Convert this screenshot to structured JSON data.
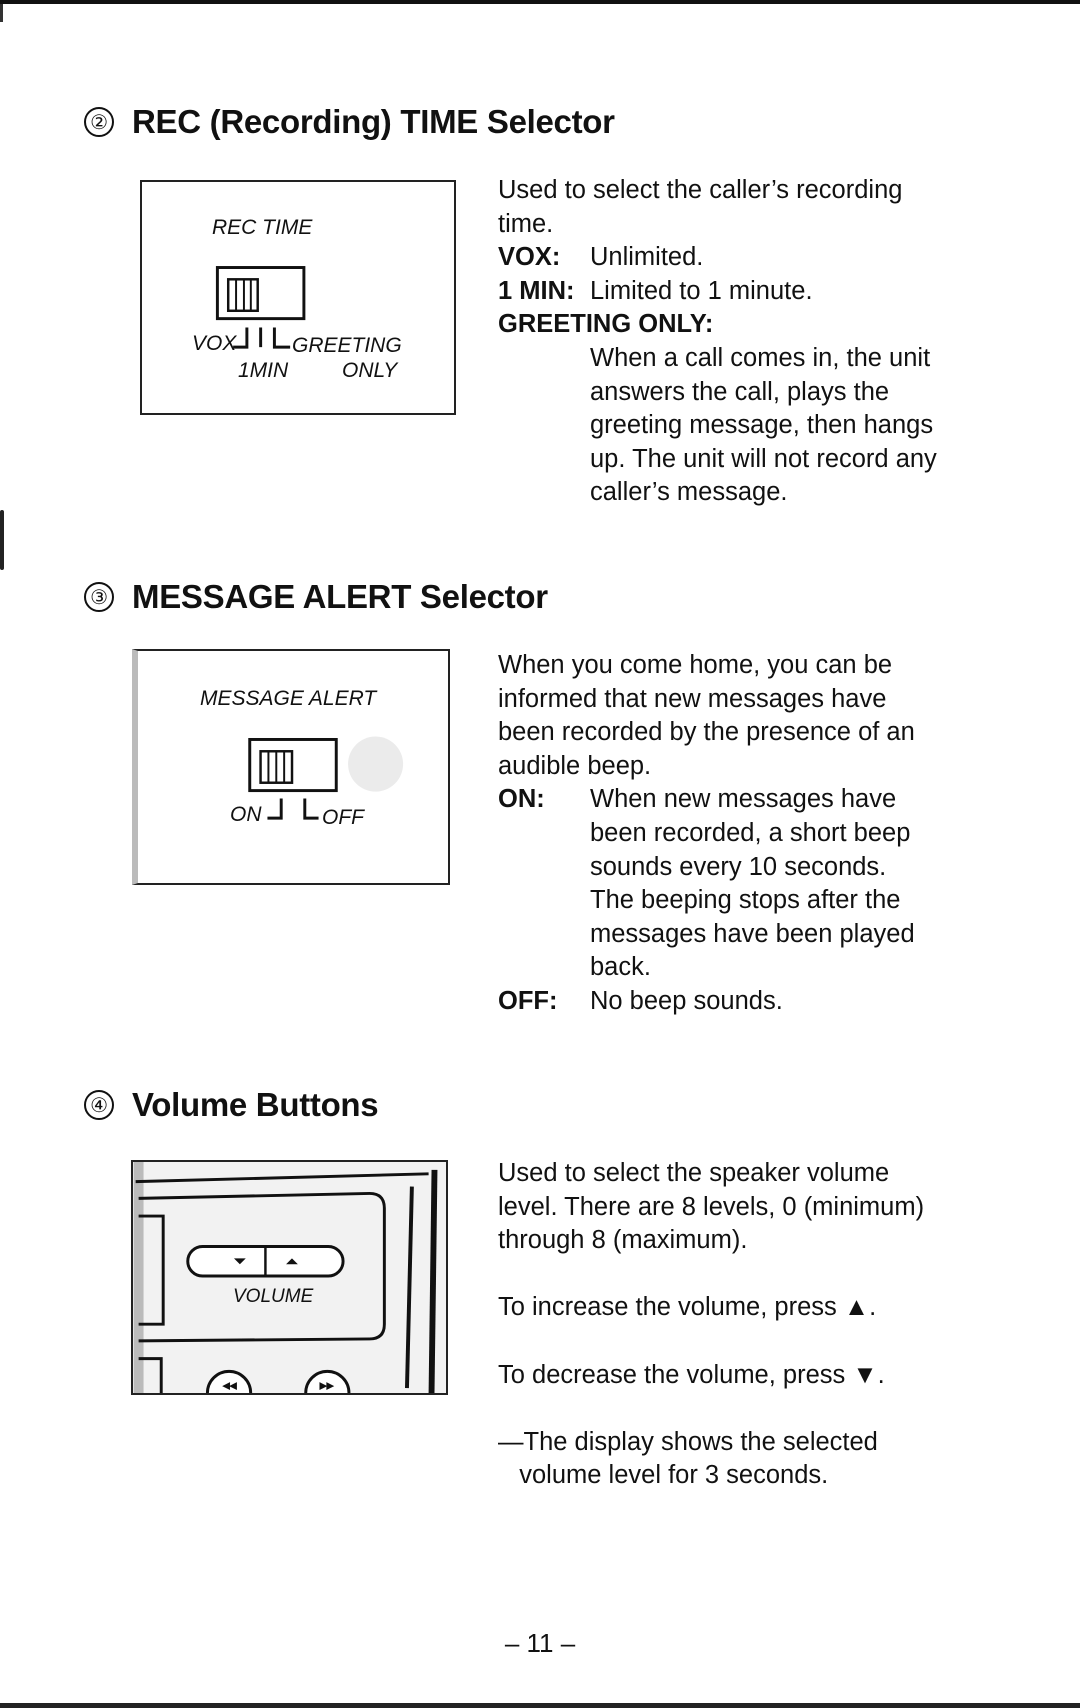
{
  "page_number": "– 11 –",
  "sections": [
    {
      "number": "②",
      "title": "REC (Recording) TIME Selector",
      "diagram": {
        "label": "REC TIME",
        "left_label": "VOX",
        "right_label": "GREETING",
        "below_center": "1MIN",
        "below_right": "ONLY"
      },
      "intro": [
        "Used to select the caller’s recording",
        "time."
      ],
      "items": [
        {
          "label": "VOX:",
          "text": [
            "Unlimited."
          ]
        },
        {
          "label": "1 MIN:",
          "text": [
            "Limited to 1 minute."
          ]
        },
        {
          "label": "GREETING ONLY:",
          "text": [
            "When a call comes in, the unit",
            "answers the call, plays the",
            "greeting message, then hangs",
            "up. The unit will not record any",
            "caller’s message."
          ]
        }
      ]
    },
    {
      "number": "③",
      "title": "MESSAGE ALERT Selector",
      "diagram": {
        "label": "MESSAGE ALERT",
        "left_label": "ON",
        "right_label": "OFF"
      },
      "intro": [
        "When you come home, you can be",
        "informed that new messages have",
        "been recorded by the presence of an",
        "audible beep."
      ],
      "items": [
        {
          "label": "ON:",
          "text": [
            "When new messages have",
            "been recorded, a short beep",
            "sounds every 10 seconds.",
            "The beeping stops after the",
            "messages have been played",
            "back."
          ]
        },
        {
          "label": "OFF:",
          "text": [
            "No beep sounds."
          ]
        }
      ]
    },
    {
      "number": "④",
      "title": "Volume Buttons",
      "diagram": {
        "label": "VOLUME",
        "down_icon": "triangle-down",
        "up_icon": "triangle-up"
      },
      "paragraphs": [
        [
          "Used to select the speaker volume",
          "level. There are 8 levels, 0 (minimum)",
          "through 8 (maximum)."
        ],
        [
          "To increase the volume, press ▲."
        ],
        [
          "To decrease the volume, press ▼."
        ],
        [
          "—The display shows the selected",
          "   volume level for 3 seconds."
        ]
      ]
    }
  ]
}
